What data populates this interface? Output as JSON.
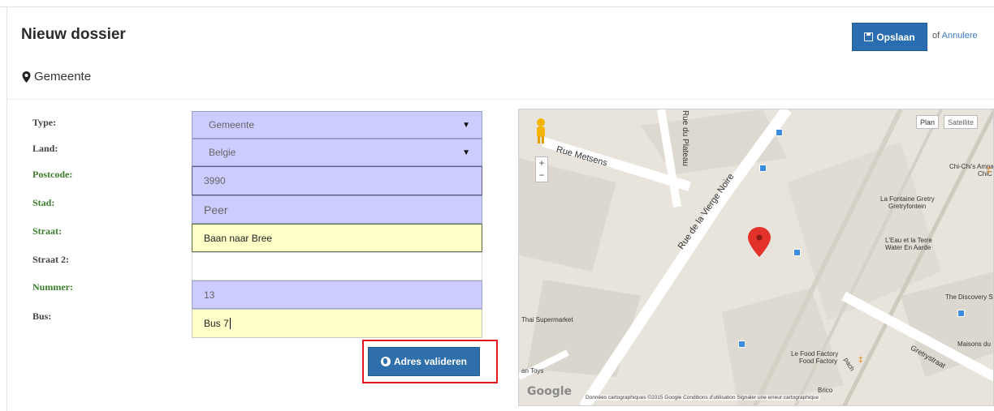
{
  "header": {
    "title": "Nieuw dossier",
    "save_label": "Opslaan",
    "or_text": "of",
    "cancel_label": "Annulere"
  },
  "section": {
    "title": "Gemeente"
  },
  "form": {
    "labels": {
      "type": "Type:",
      "land": "Land:",
      "postcode": "Postcode:",
      "stad": "Stad:",
      "straat": "Straat:",
      "straat2": "Straat 2:",
      "nummer": "Nummer:",
      "bus": "Bus:"
    },
    "values": {
      "type": "Gemeente",
      "land": "Belgie",
      "postcode": "3990",
      "stad": "Peer",
      "straat": "Baan naar Bree",
      "straat2": "",
      "nummer": "13",
      "bus": "Bus 7"
    },
    "validate_label": "Adres valideren"
  },
  "map": {
    "btn_plan": "Plan",
    "btn_satellite": "Satellite",
    "streets": {
      "rue_metsens": "Rue Metsens",
      "vierge_noire": "Rue de la Vierge Noire",
      "plateau": "Rue du Plateau",
      "gretrystraat": "Gretrystraat",
      "pach": "pach"
    },
    "places": {
      "chichis": "Chi-Chi's Ampa",
      "chichis2": "ChiC",
      "fontaine1": "La Fontaine Gretry",
      "fontaine2": "Gretryfontein",
      "eau1": "L'Eau et la Terre",
      "eau2": "Water En Aarde",
      "discovery": "The Discovery Sto",
      "thai": "Thai Supermarket",
      "foodfactory1": "Le Food Factory",
      "foodfactory2": "Food Factory",
      "maisons": "Maisons du",
      "toys": "an Toys",
      "brico": "Brico"
    },
    "footer": "Données cartographiques ©2015 Google   Conditions d'utilisation   Signaler une erreur cartographique",
    "logo": "Google"
  },
  "colors": {
    "primary": "#2a6db0",
    "purple_field": "#ccccff",
    "yellow_field": "#ffffc8",
    "green_label": "#3a7d2a",
    "highlight_red": "#e0161c"
  }
}
